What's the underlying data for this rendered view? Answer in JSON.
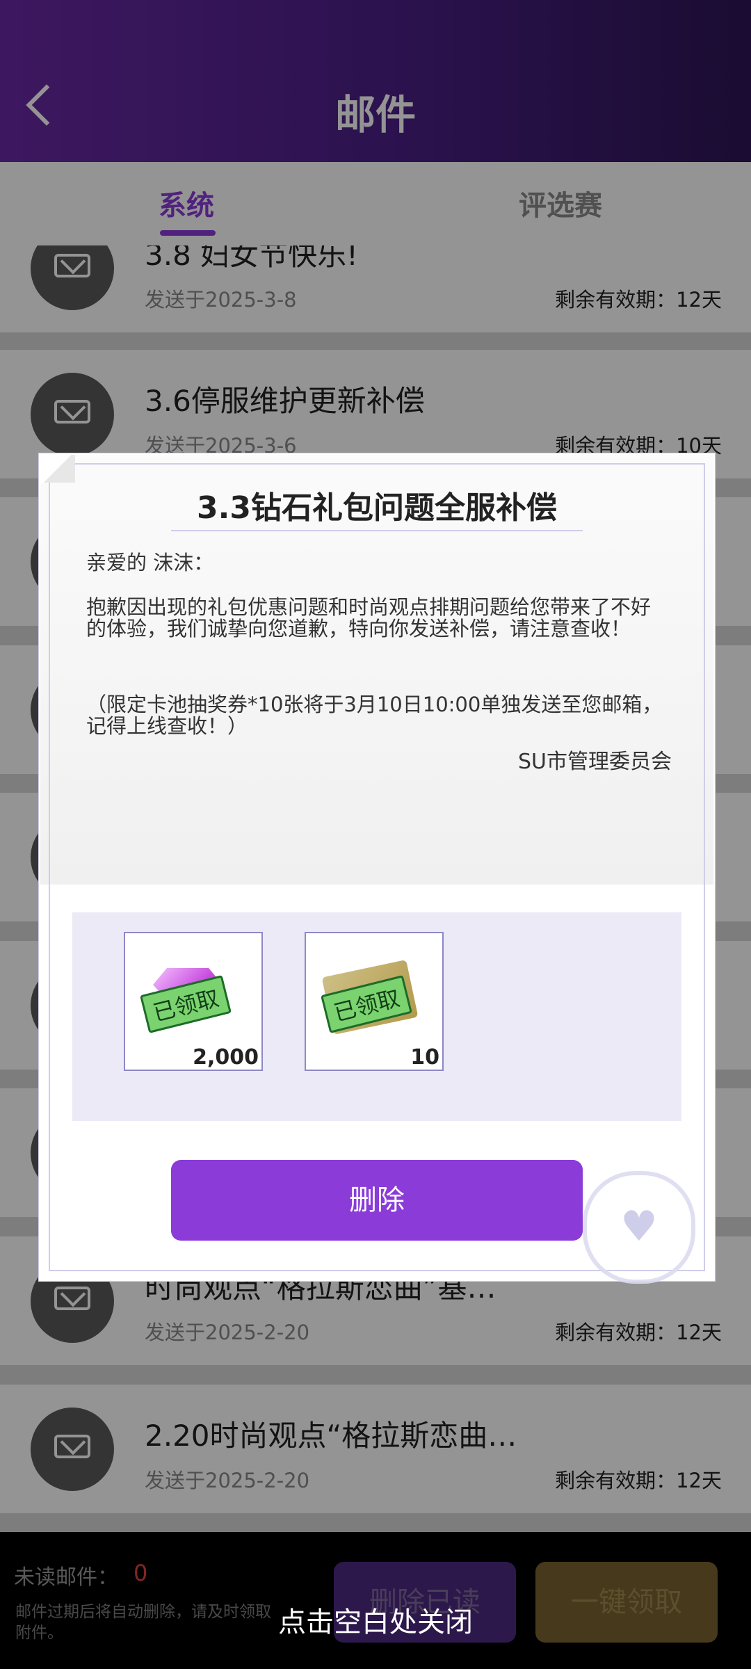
{
  "header": {
    "title": "邮件"
  },
  "tabs": [
    {
      "label": "系统",
      "active": true
    },
    {
      "label": "评选赛",
      "active": false
    }
  ],
  "mail_list": [
    {
      "title": "3.8 妇女节快乐!",
      "date": "发送于2025-3-8",
      "expiry": "剩余有效期：12天"
    },
    {
      "title": "3.6停服维护更新补偿",
      "date": "发送于2025-3-6",
      "expiry": "剩余有效期：10天"
    },
    {
      "title": "时尚观点“格拉斯恋曲”基…",
      "date": "发送于2025-2-20",
      "expiry": "剩余有效期：12天"
    },
    {
      "title": "2.20时尚观点“格拉斯恋曲…",
      "date": "发送于2025-2-20",
      "expiry": "剩余有效期：12天"
    }
  ],
  "dialog": {
    "title": "3.3钻石礼包问题全服补偿",
    "greeting": "亲爱的 沫沫：",
    "body1": "抱歉因出现的礼包优惠问题和时尚观点排期问题给您带来了不好的体验，我们诚挚向您道歉，特向你发送补偿，请注意查收！",
    "body2": "（限定卡池抽奖券*10张将于3月10日10:00单独发送至您邮箱，记得上线查收！）",
    "signature": "SU市管理委员会",
    "rewards": [
      {
        "icon": "diamond-icon",
        "stamp": "已领取",
        "qty": "2,000"
      },
      {
        "icon": "ticket-icon",
        "stamp": "已领取",
        "qty": "10"
      }
    ],
    "delete_label": "删除"
  },
  "bottom": {
    "unread_label": "未读邮件：",
    "unread_count": "0",
    "expire_note": "邮件过期后将自动删除，请及时领取附件。",
    "delete_read_label": "删除已读",
    "claim_all_label": "一键领取",
    "close_hint": "点击空白处关闭"
  },
  "colors": {
    "accent": "#8a3bd8",
    "header": "#4a1f86"
  }
}
